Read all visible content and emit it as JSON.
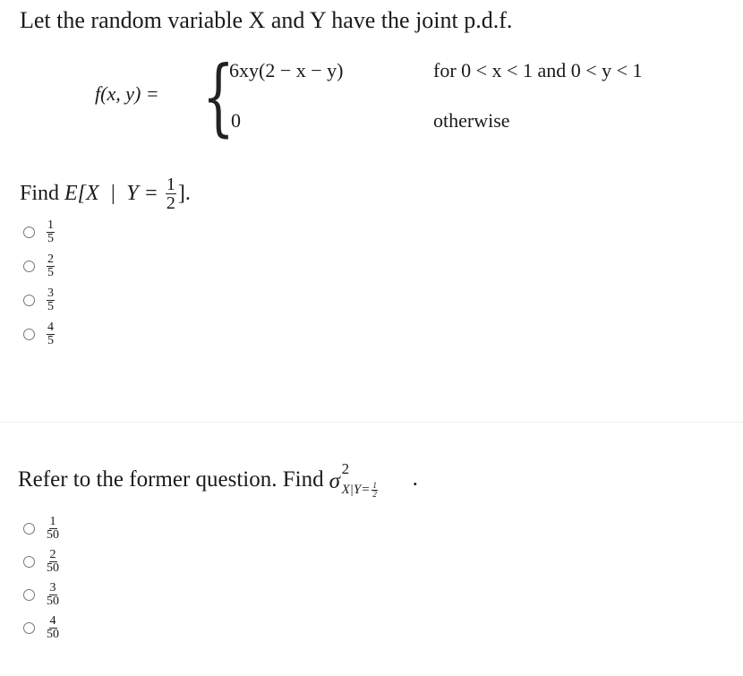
{
  "question1": {
    "intro": "Let the random variable X and Y have the joint p.d.f.",
    "pdf": {
      "lhs": "f(x, y) =",
      "cases": [
        {
          "expression": "6xy(2 − x − y)",
          "condition": "for 0 < x < 1 and 0 < y < 1"
        },
        {
          "expression": "0",
          "condition": "otherwise"
        }
      ]
    },
    "prompt": {
      "prefix": "Find",
      "expr": "E[X  |  Y =",
      "frac_num": "1",
      "frac_den": "2",
      "suffix": "]."
    },
    "options": [
      {
        "num": "1",
        "den": "5",
        "selected": false
      },
      {
        "num": "2",
        "den": "5",
        "selected": false
      },
      {
        "num": "3",
        "den": "5",
        "selected": false
      },
      {
        "num": "4",
        "den": "5",
        "selected": false
      }
    ]
  },
  "question2": {
    "prompt": {
      "text": "Refer to the former question. Find",
      "symbol": "σ",
      "superscript": "2",
      "subscript": "X|Y=",
      "sub_num": "1",
      "sub_den": "2",
      "suffix": "·"
    },
    "options": [
      {
        "num": "1",
        "den": "50",
        "selected": false
      },
      {
        "num": "2",
        "den": "50",
        "selected": false
      },
      {
        "num": "3",
        "den": "50",
        "selected": false
      },
      {
        "num": "4",
        "den": "50",
        "selected": false
      }
    ]
  }
}
